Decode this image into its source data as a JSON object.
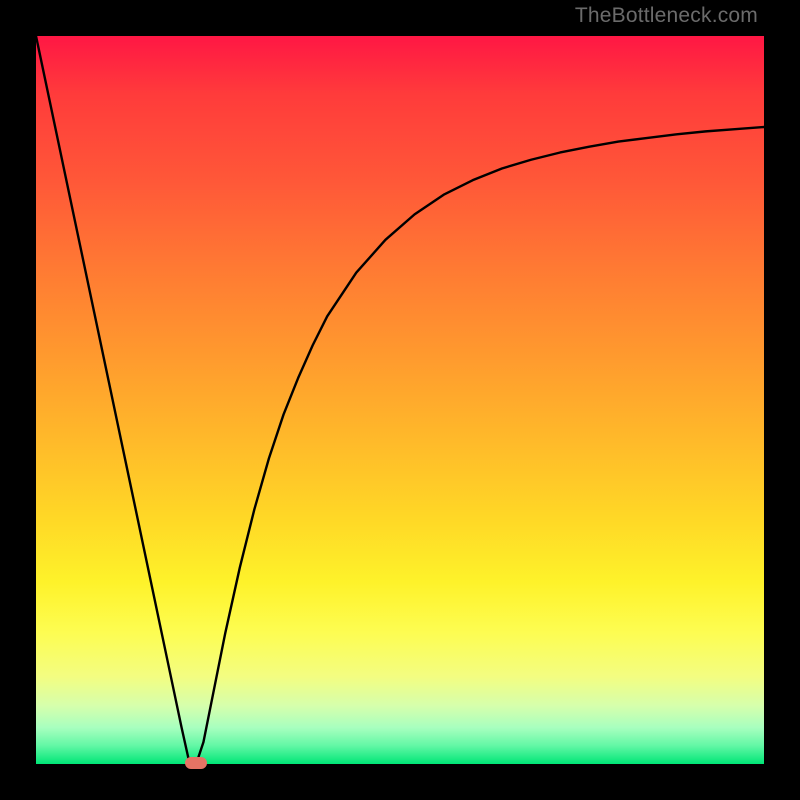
{
  "watermark": "TheBottleneck.com",
  "chart_data": {
    "type": "line",
    "title": "",
    "xlabel": "",
    "ylabel": "",
    "xlim": [
      0,
      100
    ],
    "ylim": [
      0,
      100
    ],
    "grid": false,
    "legend": false,
    "x": [
      0,
      2,
      4,
      6,
      8,
      10,
      12,
      14,
      16,
      18,
      20,
      21,
      22,
      23,
      24,
      26,
      28,
      30,
      32,
      34,
      36,
      38,
      40,
      44,
      48,
      52,
      56,
      60,
      64,
      68,
      72,
      76,
      80,
      84,
      88,
      92,
      96,
      100
    ],
    "y": [
      100,
      90.5,
      81,
      71.5,
      62,
      52.5,
      43,
      33.5,
      24,
      14.5,
      5,
      0.5,
      0,
      3,
      8,
      18,
      27,
      35,
      42,
      48,
      53,
      57.5,
      61.5,
      67.5,
      72,
      75.5,
      78.2,
      80.2,
      81.8,
      83,
      84,
      84.8,
      85.5,
      86,
      86.5,
      86.9,
      87.2,
      87.5
    ],
    "marker": {
      "x": 22,
      "y": 0
    },
    "background_gradient": {
      "top_color": "#ff1744",
      "bottom_color": "#00e676"
    },
    "frame_color": "#000000"
  }
}
